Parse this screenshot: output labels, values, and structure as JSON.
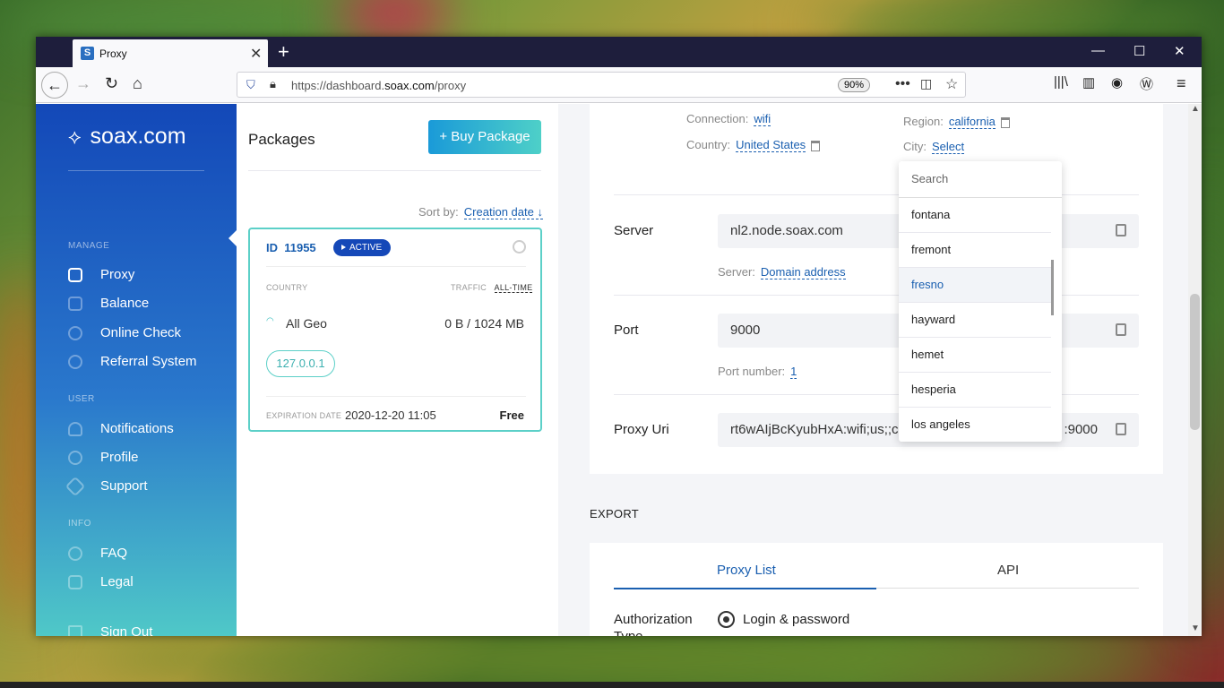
{
  "browser": {
    "tab_title": "Proxy",
    "favicon": "S",
    "url_prefix": "https://dashboard.",
    "url_domain": "soax.com",
    "url_path": "/proxy",
    "zoom": "90%"
  },
  "sidebar": {
    "logo": "soax.com",
    "sections": [
      {
        "label": "MANAGE",
        "items": [
          "Proxy",
          "Balance",
          "Online Check",
          "Referral System"
        ]
      },
      {
        "label": "USER",
        "items": [
          "Notifications",
          "Profile",
          "Support"
        ]
      },
      {
        "label": "INFO",
        "items": [
          "FAQ",
          "Legal"
        ]
      }
    ],
    "sign_out": "Sign Out",
    "active_item": "Proxy"
  },
  "packages": {
    "title": "Packages",
    "buy_label": "+ Buy Package",
    "sort_label": "Sort by:",
    "sort_value": "Creation date ↓",
    "card": {
      "id_label": "ID",
      "id": "11955",
      "status": "ACTIVE",
      "country_label": "COUNTRY",
      "traffic_label": "TRAFFIC",
      "traffic_period": "ALL-TIME",
      "geo": "All Geo",
      "traffic": "0 B / 1024 MB",
      "ip": "127.0.0.1",
      "exp_label": "EXPIRATION DATE",
      "exp_date": "2020-12-20 11:05",
      "plan": "Free"
    }
  },
  "settings": {
    "connection_label": "Connection:",
    "connection": "wifi",
    "country_label": "Country:",
    "country": "United States",
    "region_label": "Region:",
    "region": "california",
    "city_label": "City:",
    "city": "Select",
    "server_label": "Server",
    "server": "nl2.node.soax.com",
    "server_type_label": "Server:",
    "server_type": "Domain address",
    "port_label": "Port",
    "port": "9000",
    "port_number_label": "Port number:",
    "port_number": "1",
    "uri_label": "Proxy Uri",
    "uri_start": "rt6wAIjBcKyubHxA:wifi;us;;ca",
    "uri_end": ":9000"
  },
  "city_dropdown": {
    "search_placeholder": "Search",
    "items": [
      "fontana",
      "fremont",
      "fresno",
      "hayward",
      "hemet",
      "hesperia",
      "los angeles"
    ],
    "highlighted": "fresno"
  },
  "export": {
    "title": "EXPORT",
    "tabs": [
      "Proxy List",
      "API"
    ],
    "auth_label": "Authorization Type",
    "auth_option": "Login & password"
  }
}
